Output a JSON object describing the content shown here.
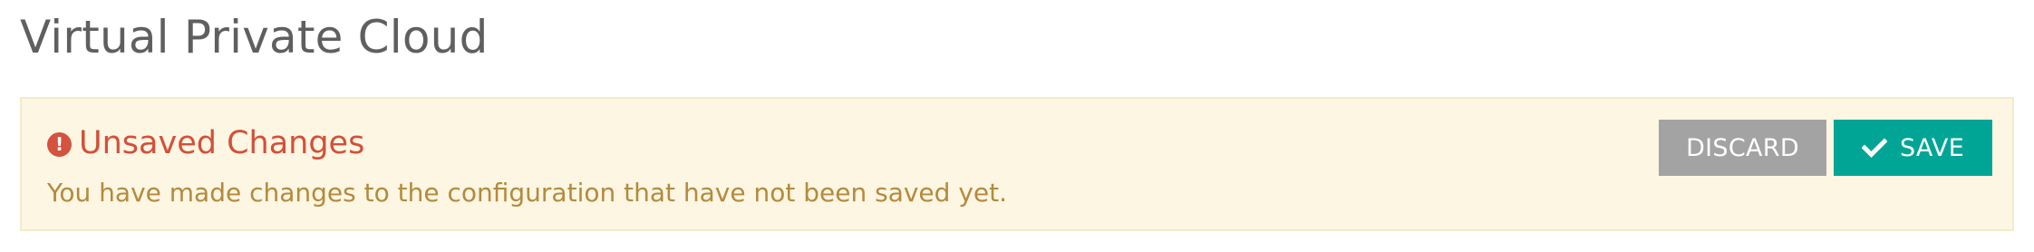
{
  "page": {
    "title": "Virtual Private Cloud"
  },
  "alert": {
    "icon": "exclamation-circle-icon",
    "title": "Unsaved Changes",
    "message": "You have made changes to the configuration that have not been saved yet.",
    "colors": {
      "background": "#fcf6e3",
      "title": "#d35039",
      "message": "#b48a3c"
    }
  },
  "actions": {
    "discard_label": "DISCARD",
    "save_label": "SAVE",
    "save_icon": "checkmark-icon",
    "colors": {
      "discard": "#a3a3a3",
      "save": "#00a595"
    }
  }
}
